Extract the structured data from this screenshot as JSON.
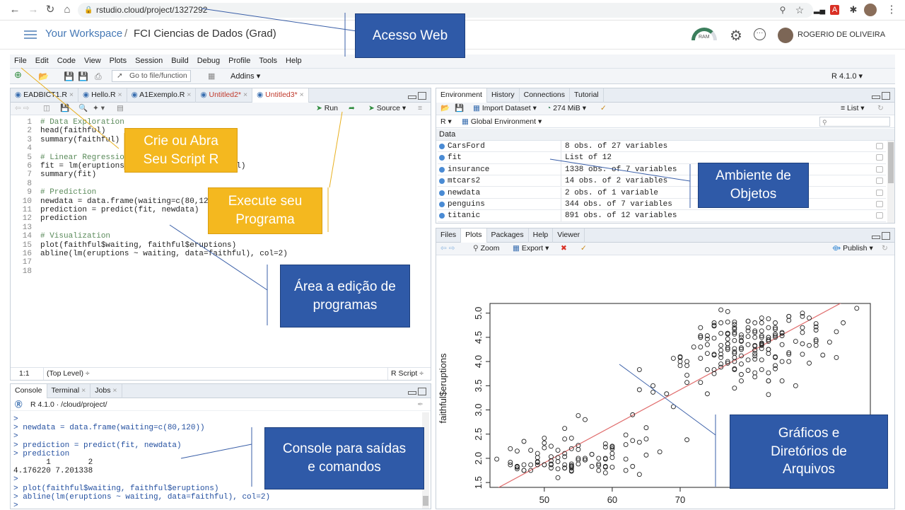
{
  "browser": {
    "url": "rstudio.cloud/project/1327292"
  },
  "cloud_header": {
    "workspace": "Your Workspace",
    "separator": "/",
    "project": "FCI Ciencias de Dados (Grad)",
    "user": "ROGERIO DE OLIVEIRA",
    "ram_label": "RAM"
  },
  "menu": [
    "File",
    "Edit",
    "Code",
    "View",
    "Plots",
    "Session",
    "Build",
    "Debug",
    "Profile",
    "Tools",
    "Help"
  ],
  "toolbar": {
    "goto_placeholder": "Go to file/function",
    "addins": "Addins",
    "r_version": "R 4.1.0"
  },
  "editor": {
    "tabs": [
      {
        "label": "EADBICT1.R",
        "modified": false
      },
      {
        "label": "Hello.R",
        "modified": false
      },
      {
        "label": "A1Exemplo.R",
        "modified": false
      },
      {
        "label": "Untitled2*",
        "modified": true
      },
      {
        "label": "Untitled3*",
        "modified": true
      }
    ],
    "run": "Run",
    "source": "Source",
    "lines": [
      "# Data Exploration",
      "head(faithful)",
      "summary(faithful)",
      "",
      "# Linear Regression",
      "fit = lm(eruptions ~ waiting, data=faithful)",
      "summary(fit)",
      "",
      "# Prediction",
      "newdata = data.frame(waiting=c(80,120))",
      "prediction = predict(fit, newdata)",
      "prediction",
      "",
      "# Visualization",
      "plot(faithful$waiting, faithful$eruptions)",
      "abline(lm(eruptions ~ waiting, data=faithful), col=2)",
      "",
      ""
    ],
    "status_pos": "1:1",
    "status_scope": "(Top Level) ÷",
    "status_type": "R Script ÷"
  },
  "console": {
    "tabs": [
      "Console",
      "Terminal",
      "Jobs"
    ],
    "path": "R 4.1.0 · /cloud/project/",
    "lines": [
      ">",
      "> newdata = data.frame(waiting=c(80,120))",
      ">",
      "> prediction = predict(fit, newdata)",
      "> prediction",
      "       1        2",
      "4.176220 7.201338",
      ">",
      "> plot(faithful$waiting, faithful$eruptions)",
      "> abline(lm(eruptions ~ waiting, data=faithful), col=2)",
      ">"
    ]
  },
  "env": {
    "tabs": [
      "Environment",
      "History",
      "Connections",
      "Tutorial"
    ],
    "import": "Import Dataset",
    "memory": "274 MiB",
    "list_view": "List",
    "lang": "R",
    "scope": "Global Environment",
    "section": "Data",
    "rows": [
      {
        "name": "CarsFord",
        "value": "8 obs. of 27 variables"
      },
      {
        "name": "fit",
        "value": "List of  12"
      },
      {
        "name": "insurance",
        "value": "1338 obs. of 7 variables"
      },
      {
        "name": "mtcars2",
        "value": "14 obs. of 2 variables"
      },
      {
        "name": "newdata",
        "value": "2 obs. of 1 variable"
      },
      {
        "name": "penguins",
        "value": "344 obs. of 7 variables"
      },
      {
        "name": "titanic",
        "value": "891 obs. of 12 variables"
      }
    ]
  },
  "files": {
    "tabs": [
      "Files",
      "Plots",
      "Packages",
      "Help",
      "Viewer"
    ],
    "zoom": "Zoom",
    "export": "Export",
    "publish": "Publish"
  },
  "chart_data": {
    "type": "scatter",
    "xlabel": "faithful$waiting",
    "ylabel": "faithful$eruptions",
    "xticks": [
      50,
      60,
      70
    ],
    "yticks": [
      1.5,
      2.0,
      2.5,
      3.0,
      3.5,
      4.0,
      4.5,
      5.0
    ],
    "xlim": [
      42,
      98
    ],
    "ylim": [
      1.4,
      5.2
    ],
    "regression": {
      "intercept": -1.874,
      "slope": 0.0756,
      "color": "#e06c6c"
    },
    "points": [
      [
        79,
        3.6
      ],
      [
        54,
        1.8
      ],
      [
        74,
        3.333
      ],
      [
        62,
        2.283
      ],
      [
        85,
        4.533
      ],
      [
        55,
        2.883
      ],
      [
        88,
        4.7
      ],
      [
        85,
        3.6
      ],
      [
        51,
        1.95
      ],
      [
        85,
        4.35
      ],
      [
        54,
        1.833
      ],
      [
        84,
        3.917
      ],
      [
        78,
        4.2
      ],
      [
        47,
        1.75
      ],
      [
        83,
        4.7
      ],
      [
        52,
        2.167
      ],
      [
        62,
        1.75
      ],
      [
        84,
        4.8
      ],
      [
        52,
        1.6
      ],
      [
        79,
        4.25
      ],
      [
        51,
        1.8
      ],
      [
        47,
        1.75
      ],
      [
        78,
        3.45
      ],
      [
        69,
        3.067
      ],
      [
        74,
        4.533
      ],
      [
        83,
        3.6
      ],
      [
        55,
        1.967
      ],
      [
        76,
        4.083
      ],
      [
        78,
        3.85
      ],
      [
        79,
        4.433
      ],
      [
        73,
        4.3
      ],
      [
        77,
        4.467
      ],
      [
        66,
        3.367
      ],
      [
        80,
        4.033
      ],
      [
        74,
        3.833
      ],
      [
        52,
        2.017
      ],
      [
        48,
        1.867
      ],
      [
        80,
        4.833
      ],
      [
        59,
        1.833
      ],
      [
        90,
        4.783
      ],
      [
        80,
        4.35
      ],
      [
        58,
        1.883
      ],
      [
        84,
        4.567
      ],
      [
        58,
        1.75
      ],
      [
        73,
        4.533
      ],
      [
        83,
        3.317
      ],
      [
        64,
        3.833
      ],
      [
        53,
        2.1
      ],
      [
        82,
        4.633
      ],
      [
        59,
        2.0
      ],
      [
        75,
        4.8
      ],
      [
        90,
        4.716
      ],
      [
        54,
        1.833
      ],
      [
        80,
        4.833
      ],
      [
        54,
        1.733
      ],
      [
        83,
        4.883
      ],
      [
        71,
        3.717
      ],
      [
        64,
        1.667
      ],
      [
        77,
        4.567
      ],
      [
        81,
        4.317
      ],
      [
        59,
        2.233
      ],
      [
        84,
        4.5
      ],
      [
        48,
        1.75
      ],
      [
        82,
        4.8
      ],
      [
        60,
        1.817
      ],
      [
        92,
        4.4
      ],
      [
        78,
        4.167
      ],
      [
        78,
        4.7
      ],
      [
        65,
        2.067
      ],
      [
        73,
        4.7
      ],
      [
        82,
        4.033
      ],
      [
        56,
        1.967
      ],
      [
        79,
        4.5
      ],
      [
        71,
        4.0
      ],
      [
        62,
        1.983
      ],
      [
        76,
        5.067
      ],
      [
        60,
        2.017
      ],
      [
        78,
        4.567
      ],
      [
        76,
        3.883
      ],
      [
        83,
        3.6
      ],
      [
        75,
        4.133
      ],
      [
        82,
        4.333
      ],
      [
        70,
        4.1
      ],
      [
        65,
        2.633
      ],
      [
        73,
        4.067
      ],
      [
        88,
        4.933
      ],
      [
        76,
        3.95
      ],
      [
        80,
        4.517
      ],
      [
        48,
        2.167
      ],
      [
        86,
        4.0
      ],
      [
        60,
        2.2
      ],
      [
        90,
        4.333
      ],
      [
        50,
        1.867
      ],
      [
        78,
        4.817
      ],
      [
        63,
        1.833
      ],
      [
        72,
        4.3
      ],
      [
        84,
        4.667
      ],
      [
        75,
        3.75
      ],
      [
        51,
        1.867
      ],
      [
        82,
        4.9
      ],
      [
        62,
        2.483
      ],
      [
        88,
        4.367
      ],
      [
        49,
        2.1
      ],
      [
        83,
        4.5
      ],
      [
        81,
        4.05
      ],
      [
        47,
        1.867
      ],
      [
        84,
        4.7
      ],
      [
        52,
        1.783
      ],
      [
        86,
        4.85
      ],
      [
        81,
        3.683
      ],
      [
        75,
        4.733
      ],
      [
        59,
        2.3
      ],
      [
        89,
        4.9
      ],
      [
        79,
        4.417
      ],
      [
        59,
        1.7
      ],
      [
        81,
        4.633
      ],
      [
        50,
        2.317
      ],
      [
        85,
        4.6
      ],
      [
        59,
        1.817
      ],
      [
        87,
        4.417
      ],
      [
        53,
        2.617
      ],
      [
        69,
        4.067
      ],
      [
        77,
        4.25
      ],
      [
        56,
        1.967
      ],
      [
        88,
        4.6
      ],
      [
        81,
        3.767
      ],
      [
        45,
        1.917
      ],
      [
        82,
        4.5
      ],
      [
        55,
        2.267
      ],
      [
        90,
        4.65
      ],
      [
        45,
        1.867
      ],
      [
        83,
        4.167
      ],
      [
        56,
        2.8
      ],
      [
        89,
        4.333
      ],
      [
        46,
        1.833
      ],
      [
        82,
        4.383
      ],
      [
        51,
        1.883
      ],
      [
        86,
        4.933
      ],
      [
        53,
        2.033
      ],
      [
        79,
        3.733
      ],
      [
        81,
        4.233
      ],
      [
        60,
        2.233
      ],
      [
        82,
        4.533
      ],
      [
        77,
        4.817
      ],
      [
        76,
        4.333
      ],
      [
        59,
        1.983
      ],
      [
        80,
        4.633
      ],
      [
        49,
        2.017
      ],
      [
        96,
        5.1
      ],
      [
        53,
        1.8
      ],
      [
        77,
        5.033
      ],
      [
        77,
        4.0
      ],
      [
        65,
        2.4
      ],
      [
        81,
        4.6
      ],
      [
        71,
        3.567
      ],
      [
        70,
        4.0
      ],
      [
        81,
        4.5
      ],
      [
        93,
        4.083
      ],
      [
        53,
        1.8
      ],
      [
        89,
        3.967
      ],
      [
        45,
        2.2
      ],
      [
        86,
        4.15
      ],
      [
        58,
        2.0
      ],
      [
        78,
        3.833
      ],
      [
        66,
        3.5
      ],
      [
        76,
        4.583
      ],
      [
        63,
        2.367
      ],
      [
        88,
        5.0
      ],
      [
        52,
        1.933
      ],
      [
        93,
        4.617
      ],
      [
        49,
        1.917
      ],
      [
        57,
        2.083
      ],
      [
        77,
        4.583
      ],
      [
        68,
        3.333
      ],
      [
        81,
        4.167
      ],
      [
        81,
        4.333
      ],
      [
        73,
        4.5
      ],
      [
        50,
        2.417
      ],
      [
        85,
        4.0
      ],
      [
        74,
        4.167
      ],
      [
        55,
        1.883
      ],
      [
        77,
        4.583
      ],
      [
        83,
        4.25
      ],
      [
        83,
        3.767
      ],
      [
        51,
        2.033
      ],
      [
        78,
        4.433
      ],
      [
        84,
        4.083
      ],
      [
        46,
        1.833
      ],
      [
        83,
        4.417
      ],
      [
        55,
        2.183
      ],
      [
        81,
        4.8
      ],
      [
        57,
        1.833
      ],
      [
        76,
        4.8
      ],
      [
        84,
        4.1
      ],
      [
        77,
        3.966
      ],
      [
        81,
        4.233
      ],
      [
        87,
        3.5
      ],
      [
        77,
        4.366
      ],
      [
        51,
        2.25
      ],
      [
        78,
        4.667
      ],
      [
        60,
        2.1
      ],
      [
        82,
        4.35
      ],
      [
        91,
        4.133
      ],
      [
        53,
        1.867
      ],
      [
        78,
        4.6
      ],
      [
        46,
        1.783
      ],
      [
        77,
        4.367
      ],
      [
        84,
        3.85
      ],
      [
        49,
        1.933
      ],
      [
        83,
        4.5
      ],
      [
        71,
        2.383
      ],
      [
        80,
        4.7
      ],
      [
        49,
        1.867
      ],
      [
        75,
        3.833
      ],
      [
        64,
        3.417
      ],
      [
        76,
        4.233
      ],
      [
        53,
        2.4
      ],
      [
        94,
        4.8
      ],
      [
        55,
        2.0
      ],
      [
        76,
        4.15
      ],
      [
        50,
        1.867
      ],
      [
        82,
        4.267
      ],
      [
        54,
        1.75
      ],
      [
        75,
        4.483
      ],
      [
        78,
        4.0
      ],
      [
        79,
        4.117
      ],
      [
        78,
        4.083
      ],
      [
        78,
        4.267
      ],
      [
        70,
        3.917
      ],
      [
        79,
        4.55
      ],
      [
        70,
        4.083
      ],
      [
        54,
        2.417
      ],
      [
        86,
        4.183
      ],
      [
        50,
        2.217
      ],
      [
        90,
        4.45
      ],
      [
        54,
        1.883
      ],
      [
        54,
        1.85
      ],
      [
        77,
        4.283
      ],
      [
        79,
        3.95
      ],
      [
        64,
        2.333
      ],
      [
        75,
        4.15
      ],
      [
        47,
        2.35
      ],
      [
        86,
        4.933
      ],
      [
        63,
        2.9
      ],
      [
        85,
        4.583
      ],
      [
        82,
        3.833
      ],
      [
        57,
        2.083
      ],
      [
        82,
        4.367
      ],
      [
        67,
        2.133
      ],
      [
        74,
        4.35
      ],
      [
        54,
        2.2
      ],
      [
        83,
        4.45
      ],
      [
        73,
        3.567
      ],
      [
        73,
        4.5
      ],
      [
        88,
        4.15
      ],
      [
        80,
        3.817
      ],
      [
        71,
        3.917
      ],
      [
        83,
        4.45
      ],
      [
        56,
        2.0
      ],
      [
        79,
        4.283
      ],
      [
        78,
        4.767
      ],
      [
        84,
        4.533
      ],
      [
        58,
        1.85
      ],
      [
        83,
        4.25
      ],
      [
        43,
        1.983
      ],
      [
        60,
        2.25
      ],
      [
        75,
        4.75
      ],
      [
        81,
        4.117
      ],
      [
        46,
        2.15
      ],
      [
        90,
        4.417
      ],
      [
        46,
        1.817
      ],
      [
        74,
        4.467
      ]
    ]
  }
}
